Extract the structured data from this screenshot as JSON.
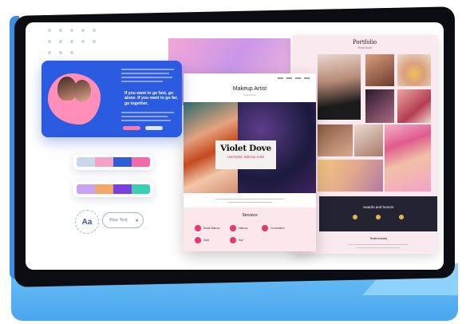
{
  "promo_card": {
    "quote": "If you want to go fast, go alone. If you want to go far, go together."
  },
  "palettes": [
    {
      "colors": [
        "#c9d6ee",
        "#f5a3c2",
        "#2f5fd8",
        "#f26aa8"
      ]
    },
    {
      "colors": [
        "#c8a3f5",
        "#f3a86a",
        "#7a3fe0",
        "#38d0b0"
      ]
    }
  ],
  "font_picker": {
    "preview": "Aa",
    "selected": "Your Text",
    "caret": "▾"
  },
  "portfolio_page": {
    "title": "Portfolio",
    "subtitle": "Violet Dove",
    "awards_title": "Awards and honors",
    "testimonials_title": "Testimonials"
  },
  "makeup_page": {
    "title": "Makeup Artist",
    "subtitle": "Violet Dove",
    "hero_name": "Violet Dove",
    "hero_tagline": "Hairstylist, Makeup Artist",
    "services_title": "Services",
    "services": [
      "Bridal Makeup",
      "Makeup",
      "Consultation",
      "Style",
      "Hair"
    ]
  },
  "colors": {
    "accent_blue": "#2b5be0",
    "accent_pink": "#e63773",
    "frame": "#0b0d12",
    "base_blue": "#4aa6ee"
  }
}
